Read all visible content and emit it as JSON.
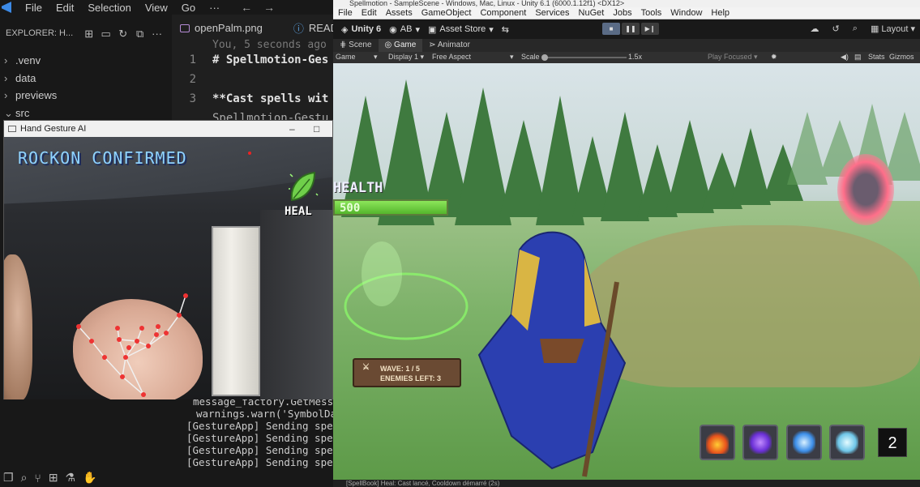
{
  "vscode": {
    "menu": [
      "File",
      "Edit",
      "Selection",
      "View",
      "Go",
      "···"
    ],
    "explorer_title": "EXPLORER: H...",
    "tree": [
      {
        "label": ".venv",
        "chev": "›"
      },
      {
        "label": "data",
        "chev": "›"
      },
      {
        "label": "previews",
        "chev": "›"
      },
      {
        "label": "src",
        "chev": "⌄"
      }
    ],
    "tabs": [
      "openPalm.png",
      "READ"
    ],
    "blame": "You, 5 seconds ago |",
    "lines": [
      {
        "n": "1",
        "text": "# Spellmotion-Ges"
      },
      {
        "n": "2",
        "text": ""
      },
      {
        "n": "3",
        "text": "**Cast spells wit"
      },
      {
        "n": "",
        "text": "Spellmotion-Gestu"
      }
    ],
    "terminal": [
      "message_factory.GetMessage",
      " warnings.warn('SymbolData",
      "[GestureApp] Sending spell",
      "[GestureApp] Sending spell",
      "[GestureApp] Sending spell",
      "[GestureApp] Sending spell"
    ]
  },
  "camera": {
    "window_title": "Hand Gesture AI",
    "gesture": "ROCKON CONFIRMED",
    "spell": "HEAL",
    "icons": [
      "heal-leaf-icon"
    ]
  },
  "unity": {
    "title": "Spellmotion - SampleScene - Windows, Mac, Linux - Unity 6.1 (6000.1.12f1) <DX12>",
    "menu": [
      "File",
      "Edit",
      "Assets",
      "GameObject",
      "Component",
      "Services",
      "NuGet",
      "Jobs",
      "Tools",
      "Window",
      "Help"
    ],
    "toolbar": {
      "account": "Unity 6",
      "ab": "AB",
      "store": "Asset Store",
      "layout": "Layout"
    },
    "tabs": [
      "Scene",
      "Game",
      "Animator"
    ],
    "gamebar": {
      "mode": "Game",
      "display": "Display 1",
      "aspect": "Free Aspect",
      "scale_label": "Scale",
      "scale_value": "1.5x",
      "play_focus": "Play Focused",
      "stats": "Stats",
      "gizmos": "Gizmos"
    },
    "hud": {
      "health_label": "HEALTH",
      "health_value": "500",
      "health_fraction": 1.0,
      "wave": "WAVE: 1 / 5",
      "enemies": "ENEMIES LEFT: 3",
      "spell_count": "2"
    },
    "status": "[SpellBook] Heal: Cast lancé, Cooldown démarré (2s)",
    "colors": {
      "health": "#6bd14a",
      "portal": "#ff6f8a",
      "hero": "#2b3fb0"
    }
  }
}
